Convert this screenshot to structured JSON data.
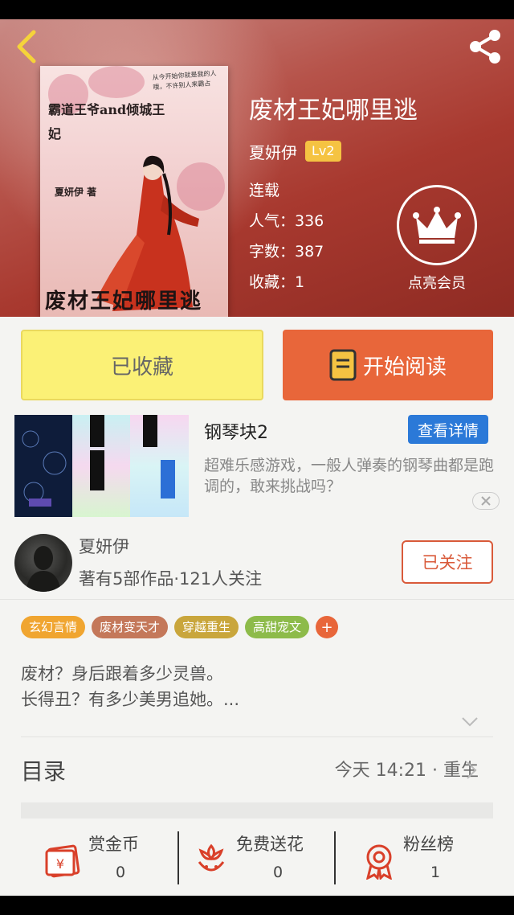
{
  "book": {
    "title": "废材王妃哪里逃",
    "author": "夏妍伊",
    "level": "Lv2",
    "status": "连载",
    "popularity": "人气：336",
    "words": "字数：387",
    "favorites": "收藏：1"
  },
  "cover": {
    "title_top": "霸道王爷and倾城王妃",
    "author_line": "夏妍伊 著",
    "poem": "从今开始你就是我的人哦，不许别人来霸占",
    "big_title": "废材王妃哪里逃"
  },
  "vip": {
    "label": "点亮会员"
  },
  "buttons": {
    "favorited": "已收藏",
    "start_reading": "开始阅读"
  },
  "ad": {
    "title": "钢琴块2",
    "detail": "查看详情",
    "description": "超难乐感游戏，一般人弹奏的钢琴曲都是跑调的，敢来挑战吗？"
  },
  "author_info": {
    "name": "夏妍伊",
    "stats": "著有5部作品·121人关注",
    "follow": "已关注"
  },
  "tags": [
    {
      "label": "玄幻言情",
      "color": "#f0a530"
    },
    {
      "label": "废材变天才",
      "color": "#c4785a"
    },
    {
      "label": "穿越重生",
      "color": "#c9a63c"
    },
    {
      "label": "高甜宠文",
      "color": "#8dbb4a"
    }
  ],
  "intro": {
    "line1": "废材？身后跟着多少灵兽。",
    "line2": "长得丑？有多少美男追她。..."
  },
  "toc": {
    "label": "目录",
    "update": "今天 14:21 · 重生"
  },
  "actions": [
    {
      "label": "赏金币",
      "count": "0",
      "icon": "coin-envelope-icon"
    },
    {
      "label": "免费送花",
      "count": "0",
      "icon": "flower-icon"
    },
    {
      "label": "粉丝榜",
      "count": "1",
      "icon": "medal-icon"
    }
  ],
  "colors": {
    "accent": "#e8663a",
    "favorite_yellow": "#fbf176",
    "ad_blue": "#2b79d8"
  }
}
